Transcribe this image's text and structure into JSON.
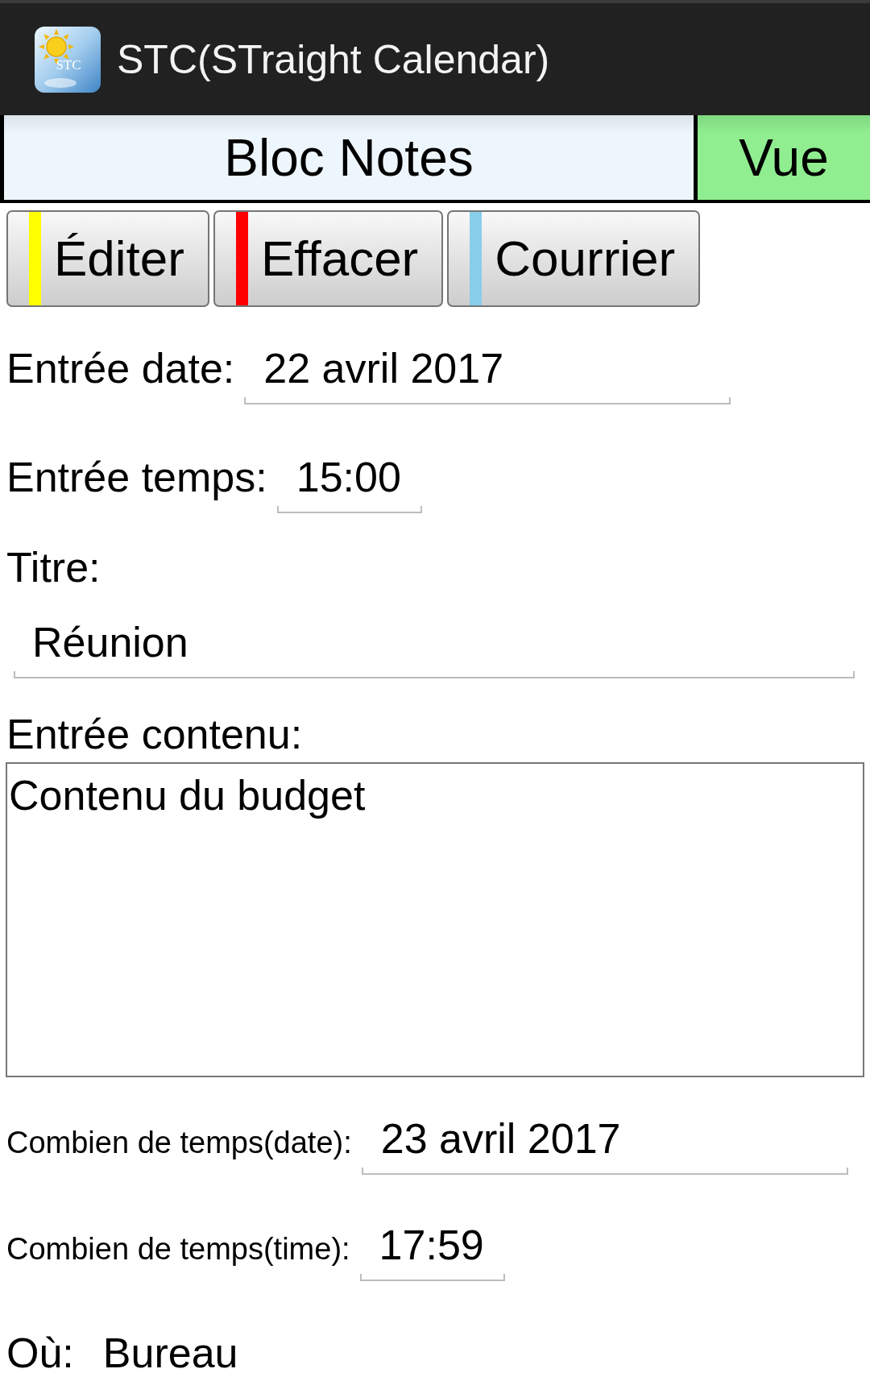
{
  "app_bar": {
    "logo_text": "STC",
    "title": "STC(STraight Calendar)"
  },
  "tabs": [
    {
      "label": "Bloc Notes",
      "selected": false
    },
    {
      "label": "Vue",
      "selected": true
    }
  ],
  "actions": [
    {
      "label": "Éditer",
      "color": "#ffff00"
    },
    {
      "label": "Effacer",
      "color": "#ff0000"
    },
    {
      "label": "Courrier",
      "color": "#87ceeb"
    }
  ],
  "start": {
    "date": {
      "label": "Entrée date:",
      "value": "22 avril 2017"
    },
    "time": {
      "label": "Entrée temps:",
      "value": "15:00"
    }
  },
  "title_field": {
    "label": "Titre:",
    "value": "Réunion"
  },
  "content": {
    "label": "Entrée contenu:",
    "value": "Contenu du budget"
  },
  "end": {
    "date": {
      "label": "Combien de temps(date):",
      "value": "23 avril 2017"
    },
    "time": {
      "label": "Combien de temps(time):",
      "value": "17:59"
    }
  },
  "location": {
    "label": "Où:",
    "value": "Bureau"
  }
}
